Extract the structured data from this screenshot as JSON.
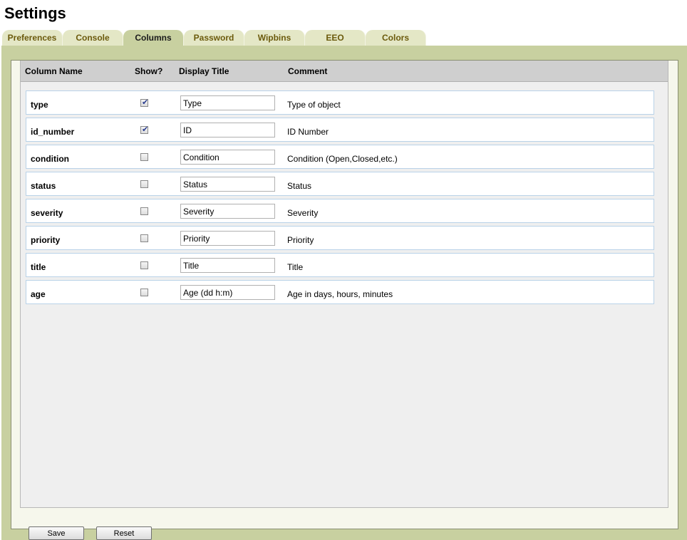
{
  "page": {
    "title": "Settings"
  },
  "tabs": [
    {
      "label": "Preferences",
      "active": false
    },
    {
      "label": "Console",
      "active": false
    },
    {
      "label": "Columns",
      "active": true
    },
    {
      "label": "Password",
      "active": false
    },
    {
      "label": "Wipbins",
      "active": false
    },
    {
      "label": "EEO",
      "active": false
    },
    {
      "label": "Colors",
      "active": false
    }
  ],
  "grid": {
    "headers": {
      "column_name": "Column Name",
      "show": "Show?",
      "display_title": "Display Title",
      "comment": "Comment"
    },
    "rows": [
      {
        "name": "type",
        "show": true,
        "display_title": "Type",
        "comment": "Type of object"
      },
      {
        "name": "id_number",
        "show": true,
        "display_title": "ID",
        "comment": "ID Number"
      },
      {
        "name": "condition",
        "show": false,
        "display_title": "Condition",
        "comment": "Condition (Open,Closed,etc.)"
      },
      {
        "name": "status",
        "show": false,
        "display_title": "Status",
        "comment": "Status"
      },
      {
        "name": "severity",
        "show": false,
        "display_title": "Severity",
        "comment": "Severity"
      },
      {
        "name": "priority",
        "show": false,
        "display_title": "Priority",
        "comment": "Priority"
      },
      {
        "name": "title",
        "show": false,
        "display_title": "Title",
        "comment": "Title"
      },
      {
        "name": "age",
        "show": false,
        "display_title": "Age (dd h:m)",
        "comment": "Age in days, hours, minutes"
      }
    ]
  },
  "buttons": {
    "save_label": "Save",
    "reset_label": "Reset"
  },
  "colors": {
    "panel": "#c8d0a0",
    "tab_inactive": "#e4e7c6",
    "tab_text": "#6b5a0c",
    "row_border": "#b9d2e8"
  },
  "icons": {
    "checked": "check-icon"
  }
}
